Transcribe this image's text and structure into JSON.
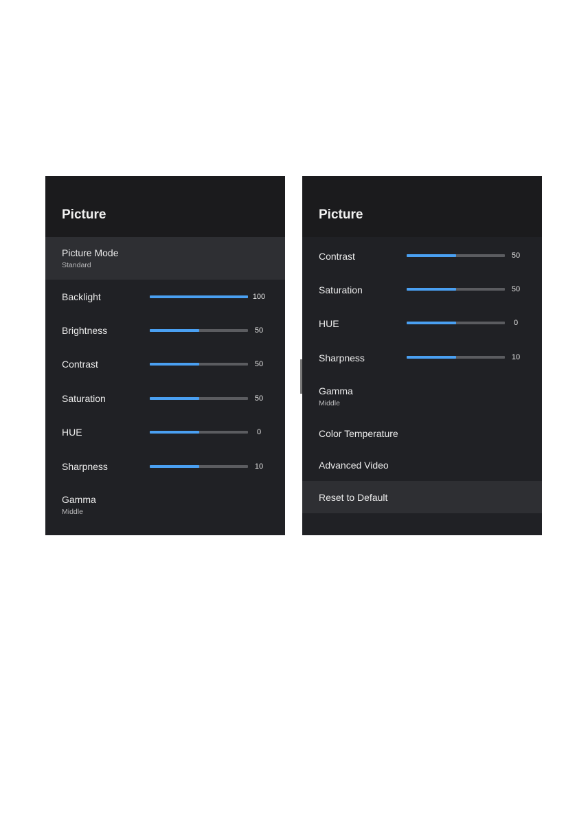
{
  "left_panel": {
    "title": "Picture",
    "picture_mode": {
      "label": "Picture Mode",
      "value": "Standard"
    },
    "sliders": [
      {
        "label": "Backlight",
        "value": "100",
        "fraction": 1.0
      },
      {
        "label": "Brightness",
        "value": "50",
        "fraction": 0.5
      },
      {
        "label": "Contrast",
        "value": "50",
        "fraction": 0.5
      },
      {
        "label": "Saturation",
        "value": "50",
        "fraction": 0.5
      },
      {
        "label": "HUE",
        "value": "0",
        "fraction": 0.5
      },
      {
        "label": "Sharpness",
        "value": "10",
        "fraction": 0.5
      }
    ],
    "gamma": {
      "label": "Gamma",
      "value": "Middle"
    }
  },
  "right_panel": {
    "title": "Picture",
    "sliders": [
      {
        "label": "Contrast",
        "value": "50",
        "fraction": 0.5
      },
      {
        "label": "Saturation",
        "value": "50",
        "fraction": 0.5
      },
      {
        "label": "HUE",
        "value": "0",
        "fraction": 0.5
      },
      {
        "label": "Sharpness",
        "value": "10",
        "fraction": 0.5
      }
    ],
    "gamma": {
      "label": "Gamma",
      "value": "Middle"
    },
    "color_temperature": {
      "label": "Color Temperature"
    },
    "advanced_video": {
      "label": "Advanced Video"
    },
    "reset_to_default": {
      "label": "Reset to Default"
    }
  },
  "colors": {
    "panel_background": "#202125",
    "header_background": "#1b1b1d",
    "highlight": "#2e2f33",
    "slider_fill": "#4aa0f2",
    "slider_track": "#5b5c60"
  }
}
